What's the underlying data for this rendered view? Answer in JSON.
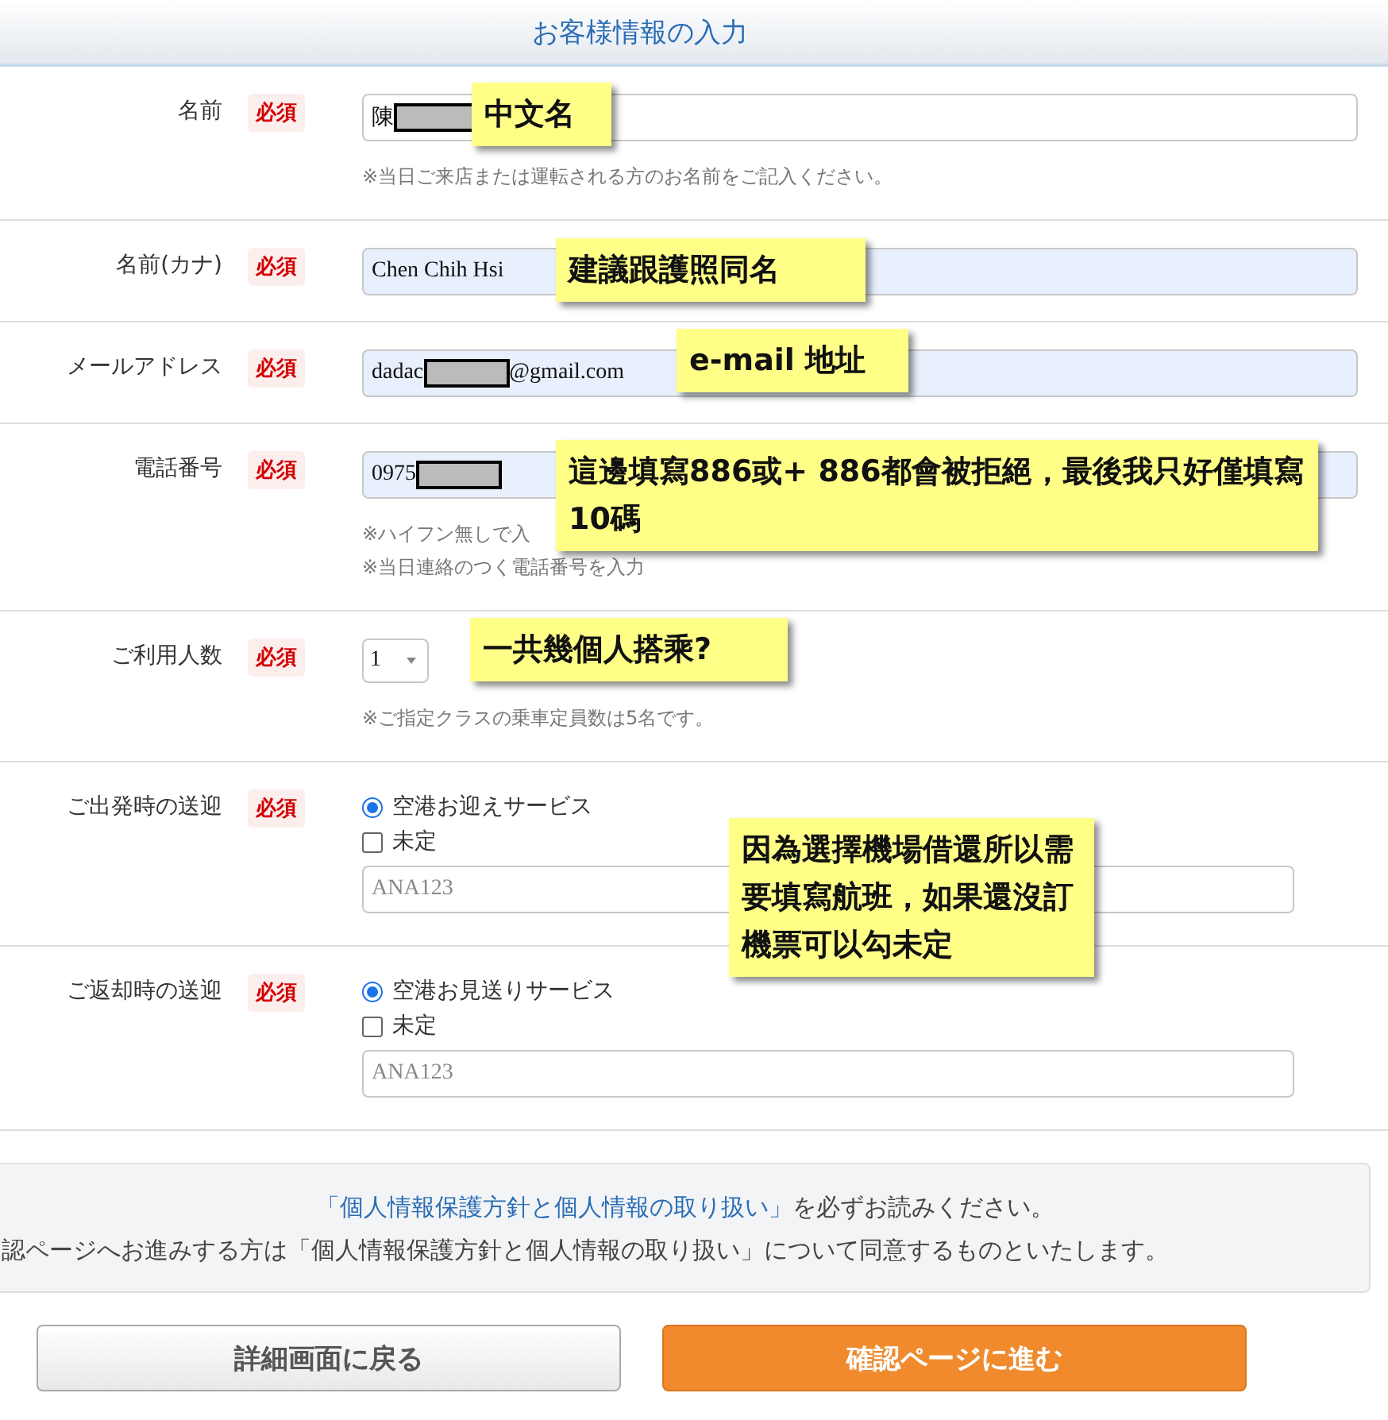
{
  "header": {
    "title": "お客様情報の入力"
  },
  "rows": [
    {
      "kind": "text",
      "label": "名前",
      "badge": "必須",
      "field": {
        "value": "陳",
        "redacted": true,
        "autofilled": false
      },
      "notes": [
        "※当日ご来店または運転される方のお名前をご記入ください。"
      ]
    },
    {
      "kind": "text",
      "label": "名前(カナ)",
      "badge": "必須",
      "field": {
        "value": "Chen Chih Hsi",
        "redacted": false,
        "autofilled": true
      },
      "notes": []
    },
    {
      "kind": "text",
      "label": "メールアドレス",
      "badge": "必須",
      "field": {
        "value": "dadac",
        "value_after": "@gmail.com",
        "redacted": true,
        "autofilled": true
      },
      "notes": []
    },
    {
      "kind": "text",
      "label": "電話番号",
      "badge": "必須",
      "field": {
        "value": "0975",
        "redacted": true,
        "autofilled": true
      },
      "notes": [
        "※ハイフン無しで入",
        "※当日連絡のつく電話番号を入力"
      ]
    },
    {
      "kind": "select",
      "label": "ご利用人数",
      "badge": "必須",
      "value": "1",
      "notes": [
        "※ご指定クラスの乗車定員数は5名です。"
      ]
    },
    {
      "kind": "transfer",
      "label": "ご出発時の送迎",
      "badge": "必須",
      "radio": {
        "label": "空港お迎えサービス",
        "selected": true
      },
      "checkbox": {
        "label": "未定",
        "checked": false
      },
      "flight": {
        "placeholder": "ANA123"
      }
    },
    {
      "kind": "transfer",
      "label": "ご返却時の送迎",
      "badge": "必須",
      "radio": {
        "label": "空港お見送りサービス",
        "selected": true
      },
      "checkbox": {
        "label": "未定",
        "checked": false
      },
      "flight": {
        "placeholder": "ANA123"
      }
    }
  ],
  "notice": {
    "link": "「個人情報保護方針と個人情報の取り扱い」",
    "line1_after": "を必ずお読みください。",
    "line2": "認ページへお進みする方は「個人情報保護方針と個人情報の取り扱い」について同意するものといたします。"
  },
  "buttons": [
    {
      "label": "詳細画面に戻る",
      "kind": "secondary"
    },
    {
      "label": "確認ページに進む",
      "kind": "primary"
    }
  ],
  "callouts": [
    "中文名",
    "建議跟護照同名",
    "e-mail 地址",
    "這邊填寫886或+ 886都會被拒絕，最後我只好僅填寫10碼",
    "一共幾個人搭乘?",
    "因為選擇機場借還所以需要填寫航班，如果還沒訂機票可以勾未定"
  ]
}
